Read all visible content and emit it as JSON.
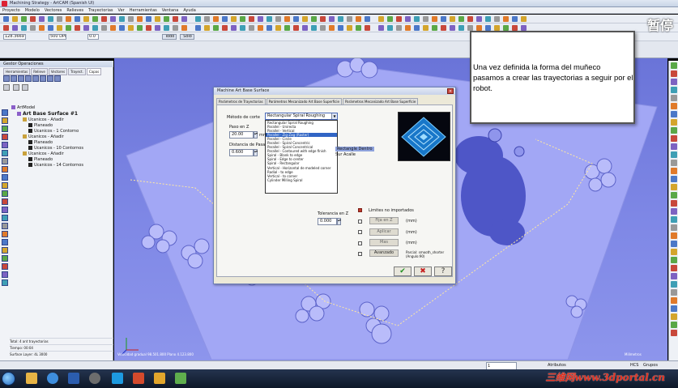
{
  "window": {
    "title": "Machining Strategy - ArtCAM (Spanish UI)"
  },
  "menus": [
    "Proyecto",
    "Modelo",
    "Vectores",
    "Relieves",
    "Trayectorias",
    "Ver",
    "Herramientas",
    "Ventana",
    "Ayuda"
  ],
  "toolbar": {
    "field_1": "128.3669",
    "field_2": "500 DPI",
    "field_3": "0.0",
    "btn_todo": "Todo",
    "btn_solo": "Solo"
  },
  "pause_label": "暂停",
  "left_panel": {
    "header": "Gestor Operaciones",
    "tabs": [
      "Herramientas",
      "Relieve",
      "Vectores",
      "Trayect.",
      "Capas"
    ],
    "tree": [
      {
        "label": "ArtModel",
        "level": 0,
        "bold": false,
        "icon": "folder"
      },
      {
        "label": "Art Base Surface #1",
        "level": 1,
        "bold": true,
        "icon": "folder"
      },
      {
        "label": "Ucanicos - Añadir",
        "level": 2,
        "bold": false,
        "icon": "op"
      },
      {
        "label": "Planeado",
        "level": 3,
        "bold": false,
        "icon": "tool"
      },
      {
        "label": "Ucanicos - 1 Contorno",
        "level": 3,
        "bold": false,
        "icon": "tool"
      },
      {
        "label": "Ucanicos - Añadir",
        "level": 2,
        "bold": false,
        "icon": "op"
      },
      {
        "label": "Planeado",
        "level": 3,
        "bold": false,
        "icon": "tool"
      },
      {
        "label": "Ucanicos - 10 Contornos",
        "level": 3,
        "bold": false,
        "icon": "tool"
      },
      {
        "label": "Ucanicos - Añadir",
        "level": 2,
        "bold": false,
        "icon": "op"
      },
      {
        "label": "Planeado",
        "level": 3,
        "bold": false,
        "icon": "tool"
      },
      {
        "label": "Ucanicos - 14 Contornos",
        "level": 3,
        "bold": false,
        "icon": "tool"
      }
    ],
    "status_lines": [
      "Total: 4 ant trayectorias",
      "Tiempo: 00:04",
      "Surface Layer: 4L 3000"
    ]
  },
  "dialog": {
    "title": "Machine Art Base Surface",
    "tabs": [
      "Parámetros de Trayectorias",
      "Parámetros Mecanizado Art Base Superficie",
      "Parámetros Mecanizado Art Base Superficie",
      "Parámetros Mecanizado Art Base Superficie",
      "Avanzado"
    ],
    "active_tab": 3,
    "metodo_label": "Método de corte",
    "metodo_value": "Rectangular Spiral Roughing",
    "paso_label": "Paso en Z",
    "paso_value": "20.00",
    "mm_label": "mm",
    "distancia_label": "Distancia de Pasa",
    "distancia_value": "0.600",
    "dropdown_options": [
      "Rectangular Spiral Roughing",
      "Parallel - Unirecta",
      "Parallel - Vertical",
      "Parallel - Zig-Zag (Raster)",
      "Parallel - Circle",
      "Parallel - Spiral Concentric",
      "Parallel - Spiral Concentrical",
      "Parallel - Contoured with edge finish",
      "Spiral - Blank to edge",
      "Spiral - Edge to center",
      "Spiral - Rectangular",
      "Vertical - Horizontal de modeled corner",
      "Radial - to edge",
      "Vertical - to corner",
      "Cylinder Milling Spiral"
    ],
    "selected_option": 3,
    "side_text_1": "Rectangle Dentro",
    "side_text_2": "Sur Acalle",
    "tolerancia_label": "Tolerancia en Z",
    "tolerancia_value": "0.000",
    "limites_label": "Limites no importados",
    "gray_buttons": [
      "Fija en Z",
      "Aplicar",
      "Mas",
      "Avanzado"
    ],
    "gray_suffixes": [
      "(mm)",
      "(mm)",
      "(mm)"
    ],
    "params_note": "Parcial: smooth_shorter (Angulo:90)",
    "ok": "✔",
    "cancel": "✖",
    "help": "?"
  },
  "note_text": "Una vez definida la forma del muñeco pasamos a crear las trayectorias a seguir por el robot.",
  "viewport_status_left": "Velocidad  gradual  98.501.800  Plano  4.123.800",
  "viewport_status_right": "Milímetros",
  "statusbar": {
    "field_scale": "1",
    "label_atributos": "Atributos",
    "label_hrs": "HCS",
    "label_grupos": "Grupos"
  },
  "watermark": "三维网www.3dportal.cn",
  "colors": {
    "viewport": "#7880e0",
    "note_border": "#555555",
    "selection": "#3165c5"
  }
}
